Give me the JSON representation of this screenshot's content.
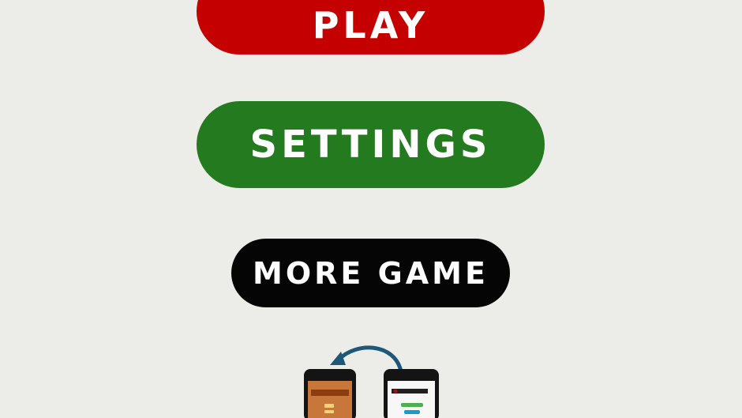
{
  "menu": {
    "play_label": "PLAY",
    "settings_label": "SETTINGS",
    "more_game_label": "MORE GAME"
  },
  "promo_graphic": {
    "icon": "phone-share-icon",
    "colors": {
      "background": "#ecede8",
      "play": "#c40000",
      "settings": "#237a1f",
      "more_game": "#050505",
      "arrow": "#1f5778"
    }
  }
}
